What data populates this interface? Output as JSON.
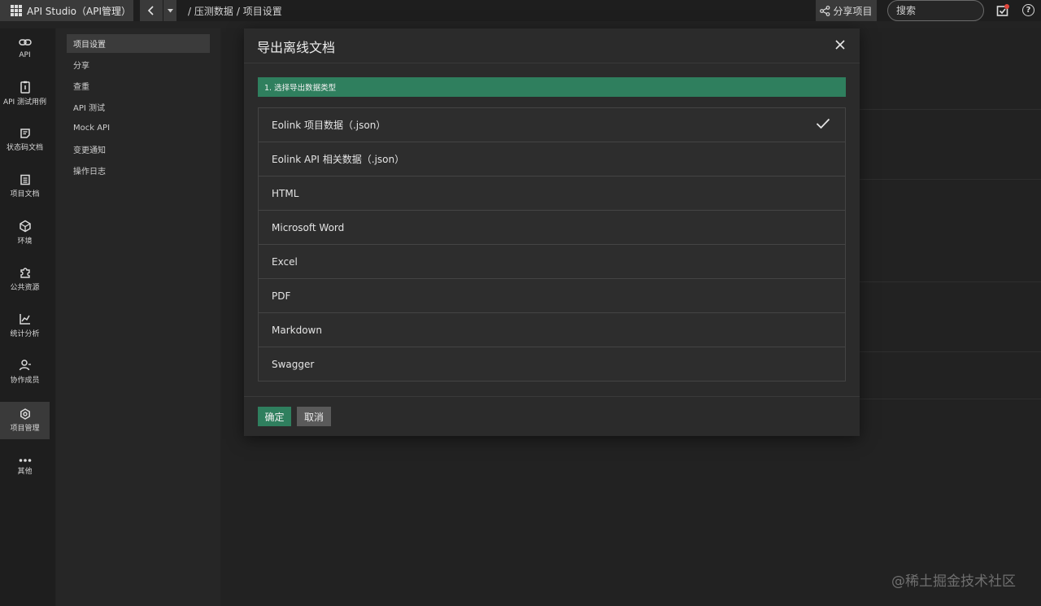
{
  "topbar": {
    "app_name": "API Studio（API管理）",
    "back_icon": "chevron-left-icon",
    "dropdown_icon": "caret-down-icon",
    "breadcrumb": [
      "/ 压测数据",
      "/ 项目设置"
    ],
    "share_label": "分享项目",
    "search_placeholder": "搜索"
  },
  "rail": {
    "items": [
      {
        "label": "API",
        "icon": "link-icon"
      },
      {
        "label": "API 测试用例",
        "icon": "test-case-icon"
      },
      {
        "label": "状态码文档",
        "icon": "status-code-icon"
      },
      {
        "label": "项目文档",
        "icon": "document-icon"
      },
      {
        "label": "环境",
        "icon": "environment-icon"
      },
      {
        "label": "公共资源",
        "icon": "puzzle-icon"
      },
      {
        "label": "统计分析",
        "icon": "chart-icon"
      },
      {
        "label": "协作成员",
        "icon": "members-icon"
      },
      {
        "label": "项目管理",
        "icon": "gear-icon"
      },
      {
        "label": "其他",
        "icon": "more-icon"
      }
    ],
    "active": "项目管理"
  },
  "subnav": {
    "items": [
      "项目设置",
      "分享",
      "查重",
      "API 测试",
      "Mock API",
      "变更通知",
      "操作日志"
    ],
    "active": "项目设置"
  },
  "modal": {
    "title": "导出离线文档",
    "close_icon": "close-icon",
    "step_label": "1. 选择导出数据类型",
    "options": [
      "Eolink 项目数据（.json）",
      "Eolink API 相关数据（.json）",
      "HTML",
      "Microsoft Word",
      "Excel",
      "PDF",
      "Markdown",
      "Swagger"
    ],
    "selected_option": "Eolink 项目数据（.json）",
    "confirm_label": "确定",
    "cancel_label": "取消"
  },
  "colors": {
    "accent_green": "#2f7f5e",
    "background": "#232323",
    "modal": "#2b2b2b"
  },
  "watermark": "@稀土掘金技术社区"
}
